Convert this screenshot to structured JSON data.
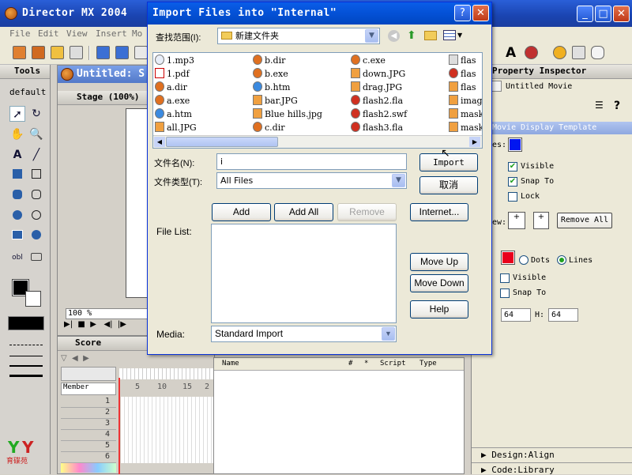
{
  "main_window": {
    "title": "Director MX 2004",
    "menu": [
      "File",
      "Edit",
      "View",
      "Insert",
      "Mo"
    ]
  },
  "tools_panel": {
    "title": "Tools",
    "mode": "default"
  },
  "stage_window": {
    "title": "Untitled: S",
    "stage_label": "Stage (100%)",
    "zoom": "100 %"
  },
  "score_panel": {
    "title": "Score",
    "member_label": "Member",
    "frame_numbers": [
      "5",
      "10",
      "15",
      "2"
    ],
    "rows": [
      "1",
      "2",
      "3",
      "4",
      "5",
      "6"
    ]
  },
  "cast_list": {
    "columns": [
      "Name",
      "#",
      "*",
      "Script",
      "Type"
    ]
  },
  "property_inspector": {
    "title": "Property Inspector",
    "movie_name": "Untitled Movie",
    "tabs": [
      "Movie",
      "Display Template"
    ],
    "checks": [
      "Visible",
      "Snap To",
      "Lock"
    ],
    "remove_all": "Remove All",
    "radio_dots": "Dots",
    "radio_lines": "Lines",
    "checks2": [
      "Visible",
      "Snap To"
    ],
    "grid_w": "64",
    "grid_h_label": "H:",
    "grid_h": "64",
    "section_align": "Design:Align",
    "section_library": "Code:Library",
    "label_es": "es:",
    "label_ew": "ew:"
  },
  "dialog": {
    "title": "Import Files into \"Internal\"",
    "look_in_label": "查找范围(I):",
    "look_in_value": "新建文件夹",
    "files": [
      [
        "1.mp3",
        "1.pdf",
        "a.dir",
        "a.exe",
        "a.htm",
        "all.JPG"
      ],
      [
        "b.dir",
        "b.exe",
        "b.htm",
        "bar.JPG",
        "Blue hills.jpg",
        "c.dir"
      ],
      [
        "c.exe",
        "down.JPG",
        "drag.JPG",
        "flash2.fla",
        "flash2.swf",
        "flash3.fla"
      ],
      [
        "flas",
        "flas",
        "flas",
        "imag",
        "mask",
        "mask"
      ]
    ],
    "filename_label": "文件名(N):",
    "filename_value": "i",
    "filetype_label": "文件类型(T):",
    "filetype_value": "All Files",
    "import_button": "Import",
    "cancel_button": "取消",
    "add_button": "Add",
    "add_all_button": "Add All",
    "remove_button": "Remove",
    "internet_button": "Internet...",
    "file_list_label": "File List:",
    "move_up_button": "Move Up",
    "move_down_button": "Move Down",
    "help_button": "Help",
    "media_label": "Media:",
    "media_value": "Standard Import"
  }
}
